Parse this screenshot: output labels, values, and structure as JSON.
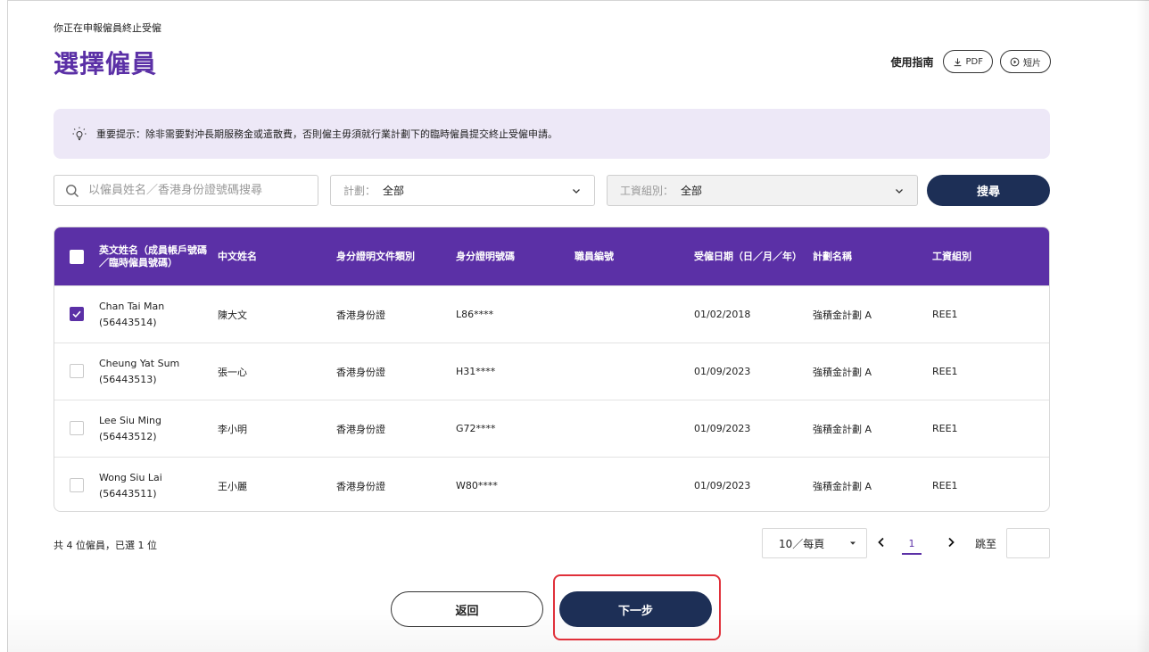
{
  "breadcrumb": "你正在申報僱員終止受僱",
  "page_title": "選擇僱員",
  "guide": {
    "label": "使用指南",
    "pdf_label": "PDF",
    "video_label": "短片"
  },
  "notice": {
    "text": "重要提示：除非需要對沖長期服務金或遣散費，否則僱主毋須就行業計劃下的臨時僱員提交終止受僱申請。"
  },
  "filters": {
    "search_placeholder": "以僱員姓名／香港身份證號碼搜尋",
    "plan_label": "計劃：",
    "plan_value": "全部",
    "group_label": "工資組別：",
    "group_value": "全部",
    "search_button": "搜尋"
  },
  "table": {
    "headers": {
      "english_name_line1": "英文姓名（成員帳戶號碼",
      "english_name_line2": "／臨時僱員號碼）",
      "chinese_name": "中文姓名",
      "id_doc_type": "身分證明文件類別",
      "id_doc_no": "身分證明號碼",
      "staff_no": "職員編號",
      "employment_date": "受僱日期（日／月／年）",
      "plan_name": "計劃名稱",
      "payroll_group": "工資組別"
    },
    "rows": [
      {
        "checked": true,
        "english_name": "Chan Tai Man",
        "account_no": "(56443514)",
        "chinese_name": "陳大文",
        "id_doc_type": "香港身份證",
        "id_doc_no": "L86****",
        "staff_no": "",
        "employment_date": "01/02/2018",
        "plan_name": "強積金計劃 A",
        "payroll_group": "REE1"
      },
      {
        "checked": false,
        "english_name": "Cheung Yat Sum",
        "account_no": "(56443513)",
        "chinese_name": "張一心",
        "id_doc_type": "香港身份證",
        "id_doc_no": "H31****",
        "staff_no": "",
        "employment_date": "01/09/2023",
        "plan_name": "強積金計劃 A",
        "payroll_group": "REE1"
      },
      {
        "checked": false,
        "english_name": "Lee Siu Ming",
        "account_no": "(56443512)",
        "chinese_name": "李小明",
        "id_doc_type": "香港身份證",
        "id_doc_no": "G72****",
        "staff_no": "",
        "employment_date": "01/09/2023",
        "plan_name": "強積金計劃 A",
        "payroll_group": "REE1"
      },
      {
        "checked": false,
        "english_name": "Wong Siu Lai",
        "account_no": "(56443511)",
        "chinese_name": "王小麗",
        "id_doc_type": "香港身份證",
        "id_doc_no": "W80****",
        "staff_no": "",
        "employment_date": "01/09/2023",
        "plan_name": "強積金計劃 A",
        "payroll_group": "REE1"
      }
    ]
  },
  "pagination": {
    "summary": "共 4 位僱員，已選 1 位",
    "page_size": "10／每頁",
    "current_page": "1",
    "jump_label": "跳至",
    "jump_value": ""
  },
  "actions": {
    "back_label": "返回",
    "next_label": "下一步"
  },
  "colors": {
    "primary_purple": "#5b30a6",
    "navy": "#1d2f56",
    "notice_bg": "#ede8f7",
    "highlight_red": "#e0303a"
  }
}
